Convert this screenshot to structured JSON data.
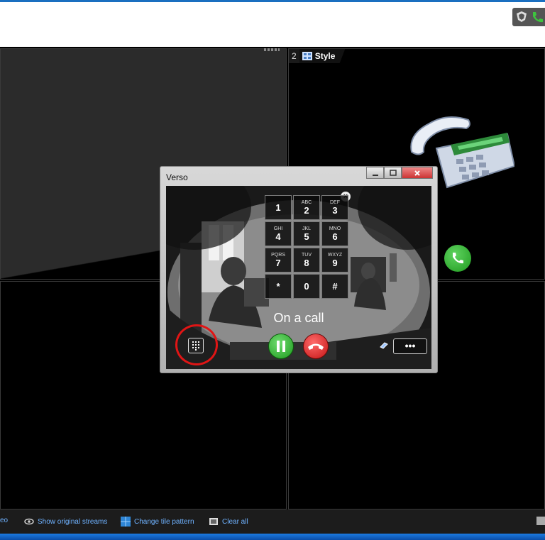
{
  "workspace": {
    "tile2": {
      "number": "2",
      "name": "Style"
    }
  },
  "dialog": {
    "title": "Verso",
    "call_status": "On a call",
    "more_label": "•••",
    "keypad": [
      {
        "digit": "1",
        "letters": ""
      },
      {
        "digit": "2",
        "letters": "ABC"
      },
      {
        "digit": "3",
        "letters": "DEF"
      },
      {
        "digit": "4",
        "letters": "GHI"
      },
      {
        "digit": "5",
        "letters": "JKL"
      },
      {
        "digit": "6",
        "letters": "MNO"
      },
      {
        "digit": "7",
        "letters": "PQRS"
      },
      {
        "digit": "8",
        "letters": "TUV"
      },
      {
        "digit": "9",
        "letters": "WXYZ"
      },
      {
        "digit": "*",
        "letters": ""
      },
      {
        "digit": "0",
        "letters": ""
      },
      {
        "digit": "#",
        "letters": ""
      }
    ]
  },
  "statusbar": {
    "cut_label": "eo",
    "show_original": "Show original streams",
    "change_tile": "Change tile pattern",
    "clear_all": "Clear all"
  },
  "colors": {
    "accent": "#1a6fc0",
    "call_green": "#2db52d",
    "hangup_red": "#d42020",
    "highlight_ring": "#e01515"
  }
}
